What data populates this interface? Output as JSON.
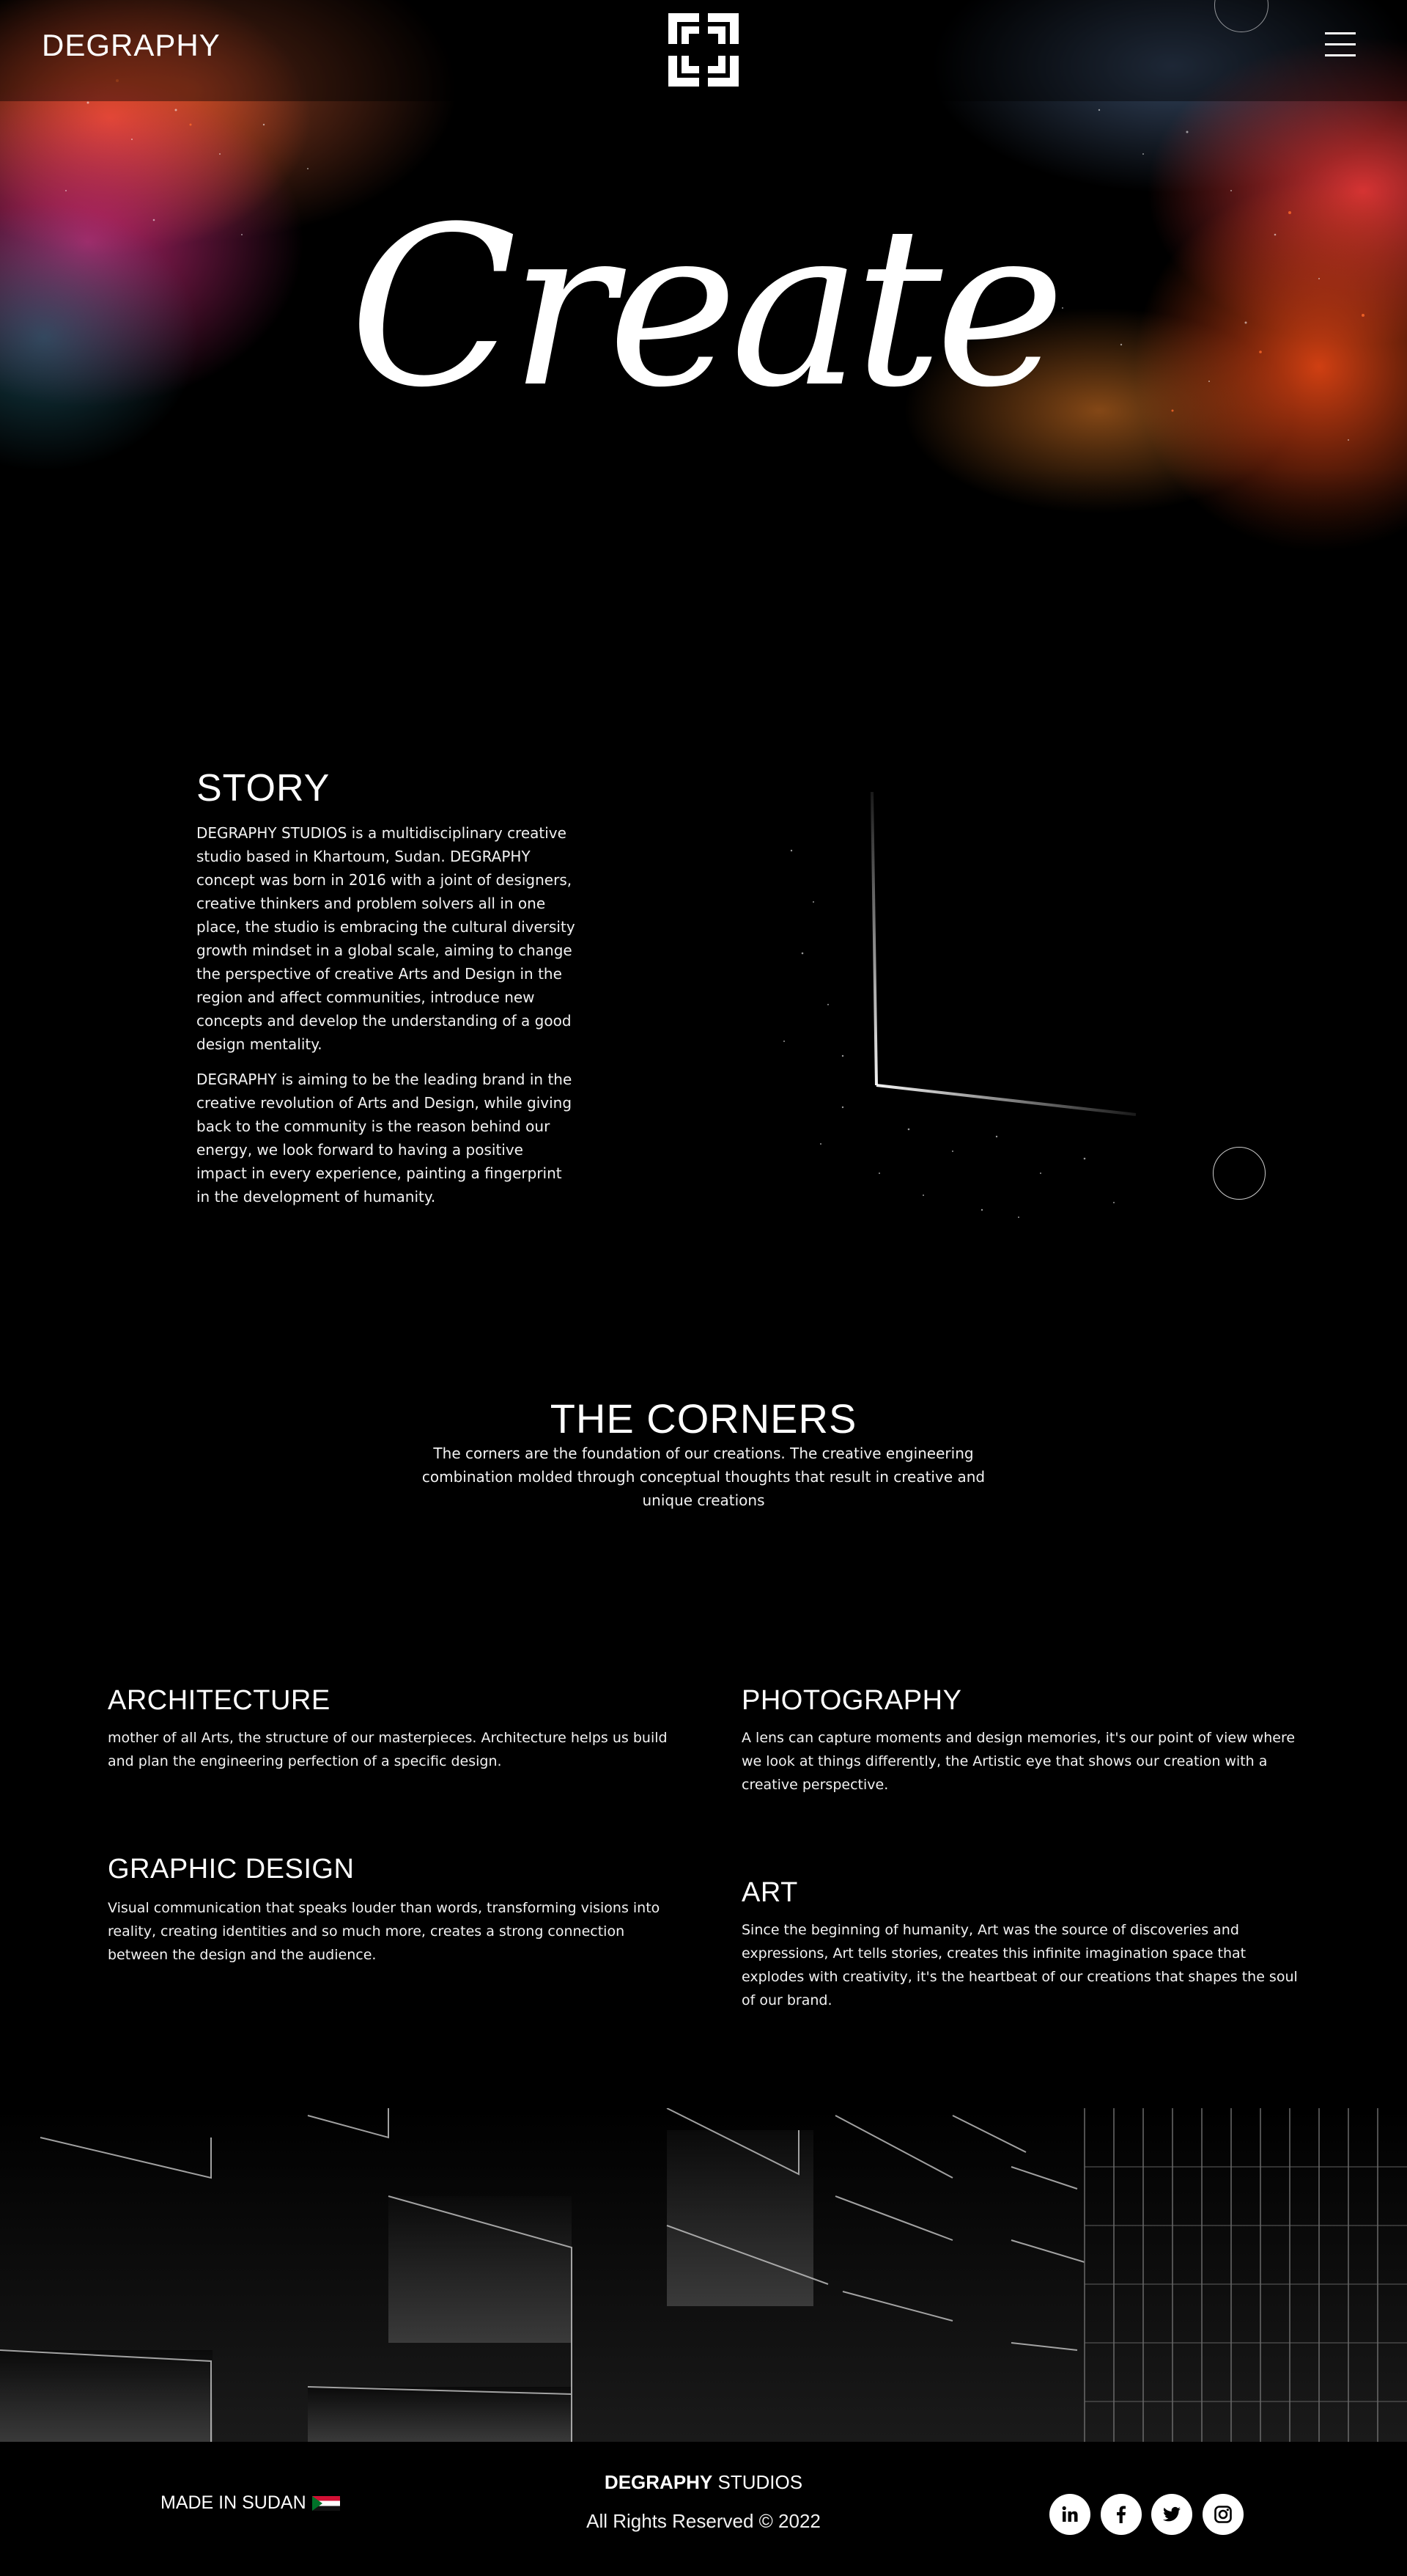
{
  "header": {
    "brand": "DEGRAPHY",
    "logo_icon": "corner-brackets-logo",
    "menu_icon": "hamburger-menu-icon"
  },
  "hero": {
    "headline": "Create"
  },
  "story": {
    "title": "STORY",
    "paragraph1": "DEGRAPHY STUDIOS is a multidisciplinary creative studio based in Khartoum, Sudan. DEGRAPHY concept was born in 2016 with a joint of designers, creative thinkers and problem solvers all in one place, the studio is embracing the cultural diversity growth mindset in a global scale, aiming to change the perspective of creative Arts and Design in the region and affect communities, introduce new concepts and develop the understanding of a good design mentality.",
    "paragraph2": "DEGRAPHY is aiming to be the leading brand in the creative revolution of Arts and Design, while giving back to the community is the reason behind our energy, we look forward to having a positive impact in every experience, painting a fingerprint in the development of humanity."
  },
  "corners": {
    "title": "THE CORNERS",
    "text": "The corners are the foundation of our creations. The creative engineering combination molded through conceptual thoughts that result in creative and unique creations"
  },
  "services": {
    "architecture": {
      "title": "ARCHITECTURE",
      "text": "mother of all Arts, the structure of our masterpieces. Architecture helps us build and plan the engineering perfection of a specific design."
    },
    "photography": {
      "title": "PHOTOGRAPHY",
      "text": "A lens can capture moments and design memories, it's our point of view where we look at things differently, the Artistic eye that shows our creation with a creative perspective."
    },
    "graphic_design": {
      "title": "GRAPHIC DESIGN",
      "text": "Visual communication that speaks louder than words, transforming visions into reality, creating identities and so much more, creates a strong connection between the design and the audience."
    },
    "art": {
      "title": "ART",
      "text": "Since the beginning of humanity, Art was the source of discoveries and expressions, Art tells stories, creates this infinite imagination space that explodes with creativity, it's the heartbeat of our creations that shapes the soul of our brand."
    }
  },
  "footer": {
    "made_in": "MADE IN SUDAN",
    "flag_icon": "sudan-flag-icon",
    "brand_bold": "DEGRAPHY",
    "brand_rest": " STUDIOS",
    "rights": "All Rights Reserved © 2022",
    "social": [
      "linkedin-icon",
      "facebook-icon",
      "twitter-icon",
      "instagram-icon"
    ]
  }
}
